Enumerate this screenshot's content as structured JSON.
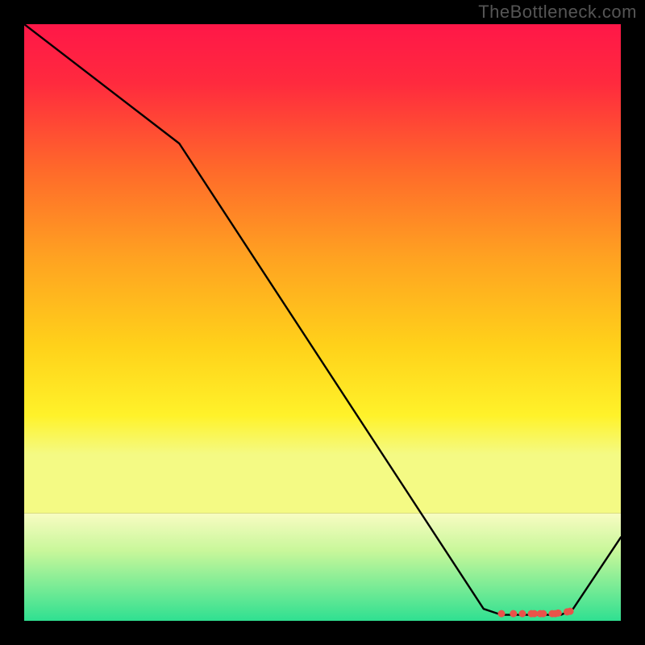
{
  "watermark": "TheBottleneck.com",
  "chart_data": {
    "type": "line",
    "title": "",
    "xlabel": "",
    "ylabel": "",
    "xlim": [
      0,
      100
    ],
    "ylim": [
      0,
      100
    ],
    "x": [
      0,
      26,
      77,
      80,
      82,
      84,
      86,
      88,
      90,
      92,
      100
    ],
    "values": [
      100,
      80,
      2,
      1,
      1,
      1,
      1,
      1,
      1,
      2,
      14
    ],
    "band": {
      "y_start": 18,
      "y_end": 0,
      "top_color": "#f8fcc2",
      "mid_color": "#c8f79a",
      "bottom_color": "#2fe091"
    },
    "gradient_stops": [
      {
        "offset": 0.0,
        "color": "#ff1748"
      },
      {
        "offset": 0.12,
        "color": "#ff2a3e"
      },
      {
        "offset": 0.3,
        "color": "#ff6a2a"
      },
      {
        "offset": 0.48,
        "color": "#ffa321"
      },
      {
        "offset": 0.66,
        "color": "#ffd21a"
      },
      {
        "offset": 0.8,
        "color": "#fff22a"
      },
      {
        "offset": 0.88,
        "color": "#f4fa84"
      }
    ],
    "line_color": "#000000",
    "marker_color": "#e9534a",
    "markers_x": [
      80,
      82,
      83.5,
      85,
      85.5,
      86.5,
      87,
      88.5,
      89,
      89.5,
      91,
      91.5
    ],
    "markers_y": [
      1.2,
      1.2,
      1.2,
      1.2,
      1.2,
      1.2,
      1.2,
      1.2,
      1.2,
      1.3,
      1.5,
      1.6
    ]
  }
}
